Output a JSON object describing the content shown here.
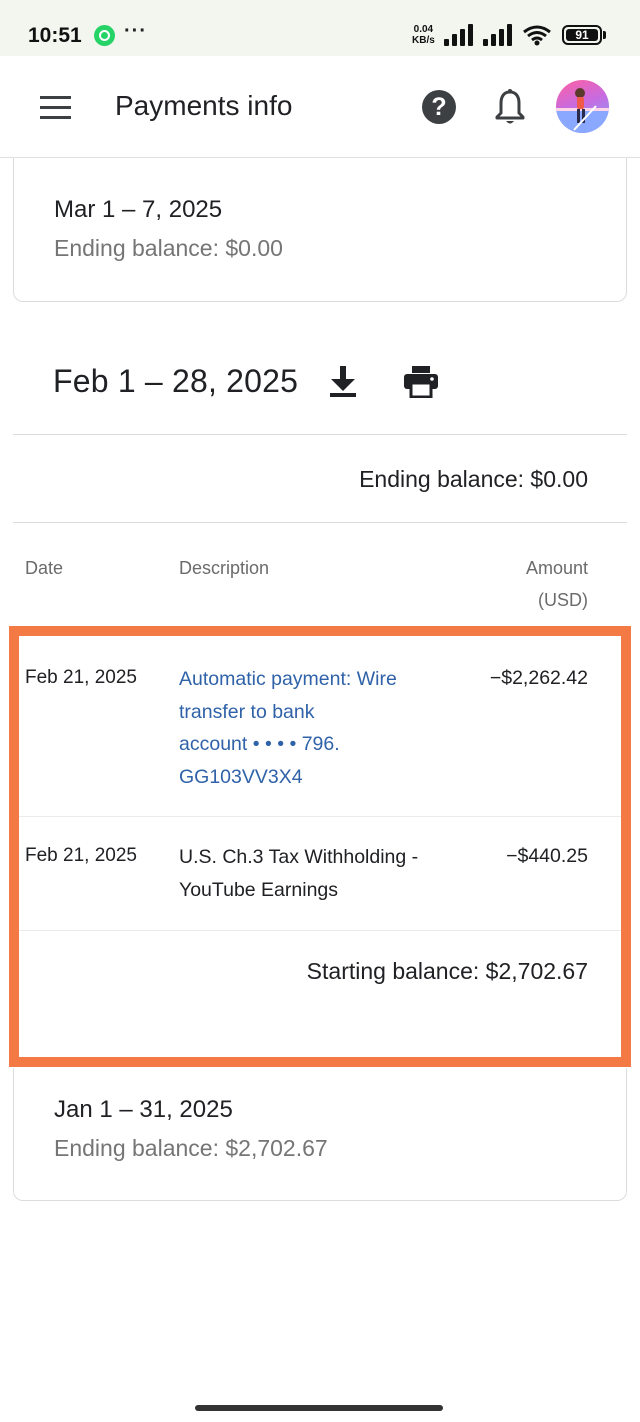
{
  "status_bar": {
    "time": "10:51",
    "more": "···",
    "net_speed_value": "0.04",
    "net_speed_unit": "KB/s",
    "battery": "91"
  },
  "app_bar": {
    "title": "Payments info",
    "help_glyph": "?"
  },
  "statements": {
    "march": {
      "period": "Mar 1 – 7, 2025",
      "ending_balance": "Ending balance: $0.00"
    },
    "february": {
      "period": "Feb 1 – 28, 2025",
      "ending_balance": "Ending balance: $0.00",
      "columns": {
        "date": "Date",
        "description": "Description",
        "amount": "Amount",
        "amount_unit": "(USD)"
      },
      "rows": [
        {
          "date": "Feb 21, 2025",
          "description_lines": [
            "Automatic payment: Wire",
            "transfer to bank",
            "account  • • • • 796.",
            "GG103VV3X4"
          ],
          "amount": "−$2,262.42"
        },
        {
          "date": "Feb 21, 2025",
          "description_lines": [
            "U.S. Ch.3 Tax Withholding -",
            "YouTube Earnings"
          ],
          "amount": "−$440.25"
        }
      ],
      "starting_balance": "Starting balance: $2,702.67"
    },
    "january": {
      "period": "Jan 1 – 31, 2025",
      "ending_balance": "Ending balance: $2,702.67"
    }
  },
  "icons": {
    "menu": "menu-icon",
    "help": "help-icon",
    "notifications": "bell-icon",
    "download": "download-icon",
    "print": "print-icon"
  },
  "colors": {
    "highlight": "#f47a45",
    "link": "#2f62a8",
    "secondary_text": "#757575",
    "status_bar_bg": "#f3f5ef"
  }
}
